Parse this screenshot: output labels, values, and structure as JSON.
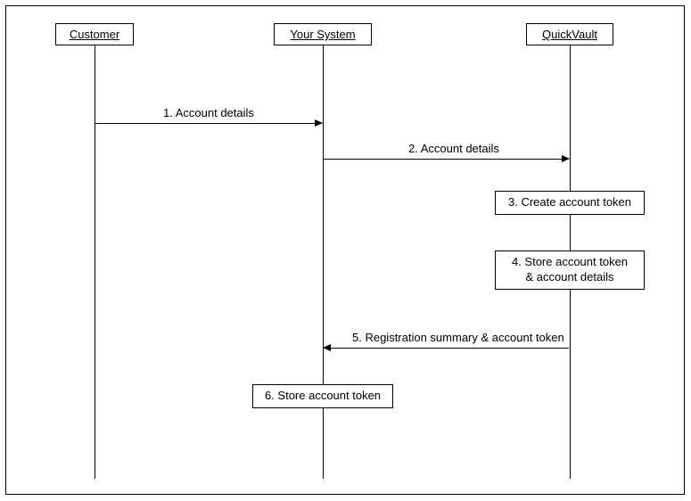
{
  "participants": {
    "customer": "Customer",
    "your_system": "Your System",
    "quickvault": "QuickVault"
  },
  "messages": {
    "m1": "1. Account details",
    "m2": "2. Account details",
    "m5": "5. Registration summary & account token"
  },
  "steps": {
    "s3": "3. Create account token",
    "s4_line1": "4. Store account token",
    "s4_line2": "& account details",
    "s6": "6. Store account token"
  }
}
